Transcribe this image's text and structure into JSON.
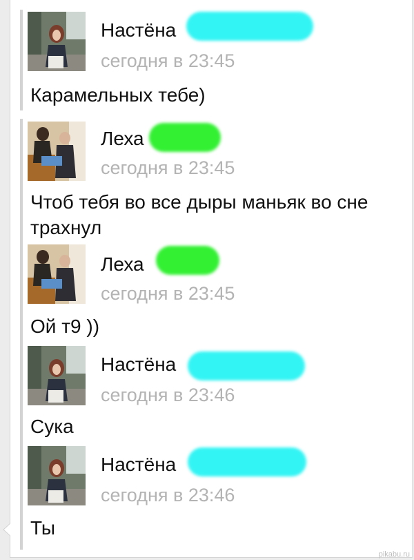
{
  "colors": {
    "background": "#ececec",
    "card": "#ffffff",
    "name": "#111111",
    "time": "#b3b3b3",
    "redact_cyan": "#33f4f4",
    "redact_green": "#33f033"
  },
  "messages": [
    {
      "author": "Настёна",
      "time": "сегодня в 23:45",
      "text": "Карамельных тебе)",
      "avatar": "girl-photo-avatar",
      "redaction": "cyan"
    },
    {
      "author": "Леха",
      "time": "сегодня в 23:45",
      "text": "Чтоб тебя во все дыры маньяк во сне трахнул",
      "avatar": "boys-photo-avatar",
      "redaction": "green"
    },
    {
      "author": "Леха",
      "time": "сегодня в 23:45",
      "text": "Ой т9 ))",
      "avatar": "boys-photo-avatar",
      "redaction": "green"
    },
    {
      "author": "Настёна",
      "time": "сегодня в 23:46",
      "text": "Сука",
      "avatar": "girl-photo-avatar",
      "redaction": "cyan"
    },
    {
      "author": "Настёна",
      "time": "сегодня в 23:46",
      "text": "Ты",
      "avatar": "girl-photo-avatar",
      "redaction": "cyan"
    }
  ],
  "watermark": "pikabu.ru"
}
